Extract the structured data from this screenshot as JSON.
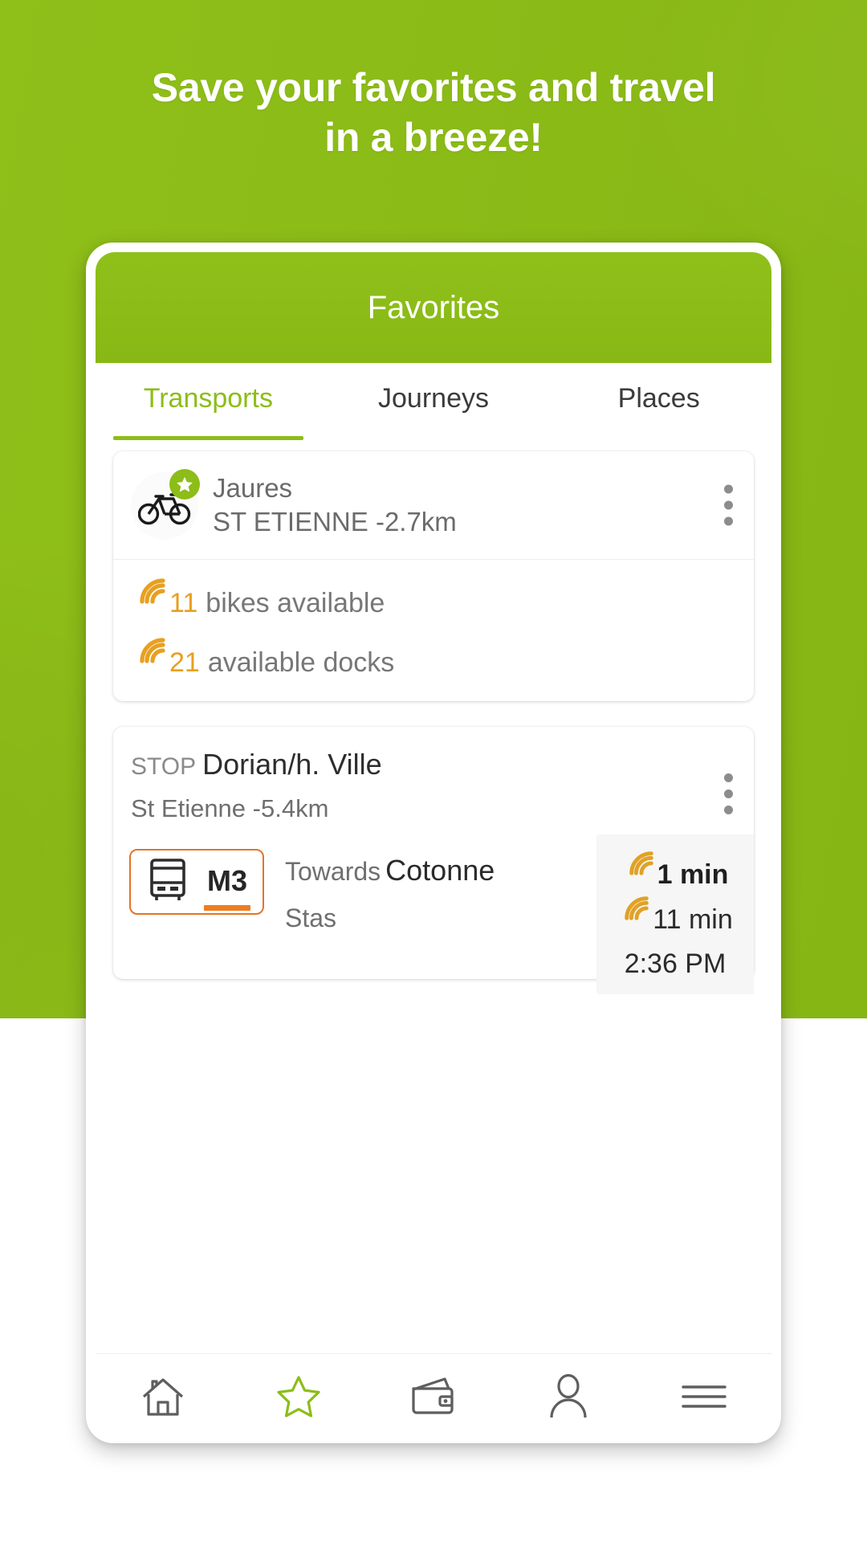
{
  "promo": {
    "headline_line1": "Save your favorites and travel",
    "headline_line2": "in a breeze!",
    "background_color": "#8cbd18"
  },
  "app": {
    "appbar_title": "Favorites",
    "accent_green": "#8cbd18",
    "accent_orange": "#ed7d22",
    "realtime_color": "#e8a020"
  },
  "tabs": [
    {
      "label": "Transports",
      "active": true
    },
    {
      "label": "Journeys",
      "active": false
    },
    {
      "label": "Places",
      "active": false
    }
  ],
  "favorites": {
    "bike_station": {
      "icon": "bicycle-icon",
      "badge_icon": "star-icon",
      "name": "Jaures",
      "city": "ST ETIENNE",
      "separator": "-",
      "distance": "2.7km",
      "menu_icon": "kebab-menu-icon",
      "stats": [
        {
          "icon": "realtime-wave-icon",
          "count": "11",
          "label": "bikes available"
        },
        {
          "icon": "realtime-wave-icon",
          "count": "21",
          "label": "available docks"
        }
      ]
    },
    "bus_stop": {
      "kind": "STOP",
      "name": "Dorian/h. Ville",
      "city": "St Etienne",
      "separator": "-",
      "distance": "5.4km",
      "menu_icon": "kebab-menu-icon",
      "line": {
        "mode_icon": "bus-icon",
        "code": "M3",
        "color": "#ed7d22",
        "direction_prefix": "Towards",
        "direction_name": "Cotonne",
        "direction_second": "Stas"
      },
      "departures": [
        {
          "icon": "realtime-wave-icon",
          "value": "1 min",
          "realtime": true,
          "emphasis": true
        },
        {
          "icon": "realtime-wave-icon",
          "value": "11 min",
          "realtime": true,
          "emphasis": false
        },
        {
          "icon": "",
          "value": "2:36 PM",
          "realtime": false,
          "emphasis": false
        }
      ]
    }
  },
  "bottom_nav": [
    {
      "icon": "home-icon",
      "active": false
    },
    {
      "icon": "star-icon",
      "active": true
    },
    {
      "icon": "wallet-icon",
      "active": false
    },
    {
      "icon": "person-icon",
      "active": false
    },
    {
      "icon": "hamburger-menu-icon",
      "active": false
    }
  ]
}
